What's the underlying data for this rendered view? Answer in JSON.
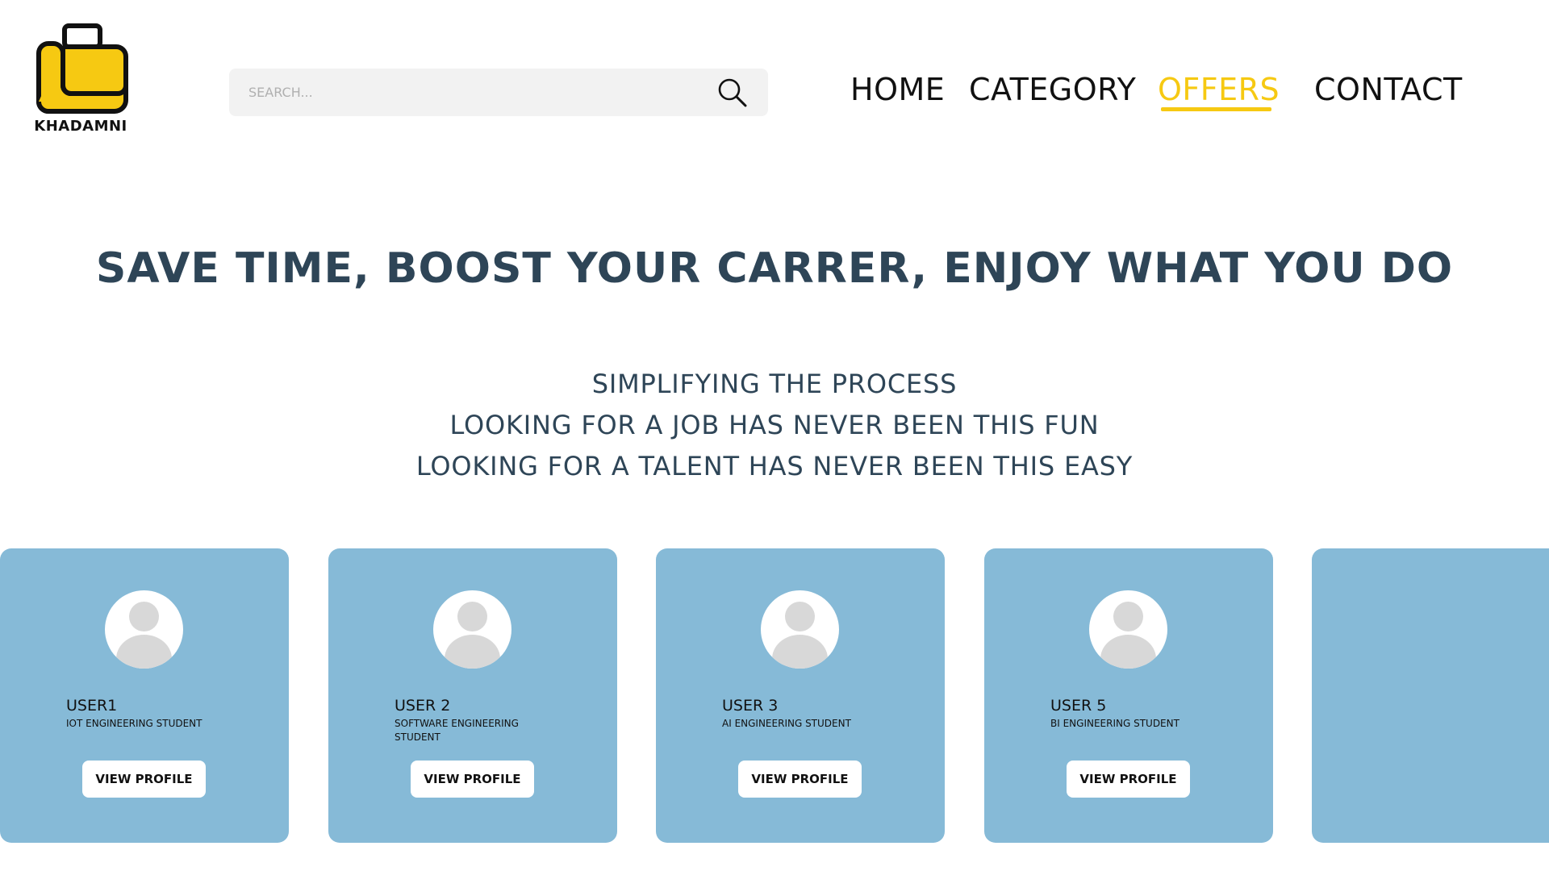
{
  "brand": {
    "name": "KHADAMNI",
    "colors": {
      "accent": "#f6c912",
      "heading": "#2e4557",
      "card": "#86bad7",
      "search_bg": "#f2f2f2"
    }
  },
  "search": {
    "placeholder": "SEARCH...",
    "icon": "search-icon"
  },
  "nav": {
    "items": [
      {
        "label": "HOME",
        "active": false
      },
      {
        "label": "CATEGORY",
        "active": false
      },
      {
        "label": "OFFERS",
        "active": true
      },
      {
        "label": "CONTACT",
        "active": false
      }
    ]
  },
  "hero": {
    "headline": "SAVE TIME, BOOST YOUR CARRER, ENJOY WHAT YOU DO",
    "lines": [
      "SIMPLIFYING THE PROCESS",
      "LOOKING FOR A JOB HAS NEVER BEEN THIS FUN",
      "LOOKING FOR A TALENT HAS NEVER BEEN THIS EASY"
    ]
  },
  "cards": [
    {
      "name": "USER1",
      "role": "IOT ENGINEERING STUDENT",
      "button": "VIEW PROFILE"
    },
    {
      "name": "USER 2",
      "role": "SOFTWARE ENGINEERING STUDENT",
      "button": "VIEW PROFILE"
    },
    {
      "name": "USER 3",
      "role": "AI ENGINEERING STUDENT",
      "button": "VIEW PROFILE"
    },
    {
      "name": "USER 5",
      "role": "BI ENGINEERING STUDENT",
      "button": "VIEW PROFILE"
    }
  ]
}
